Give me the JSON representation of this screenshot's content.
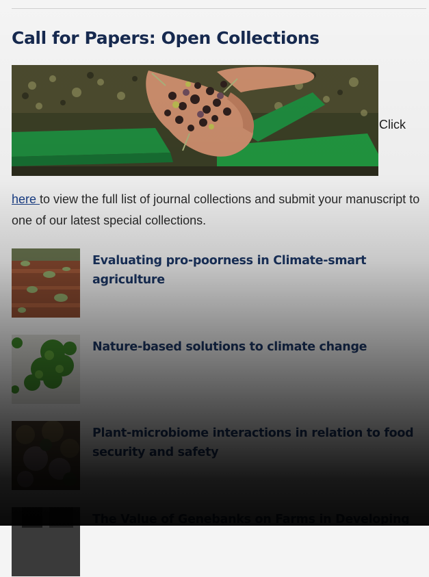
{
  "section": {
    "heading": "Call for Papers: Open Collections",
    "hero_image": "hands-holding-olives-photo",
    "click_word": "Click",
    "link_text": "here ",
    "paragraph_rest": "to view the full list of journal collections and submit your manuscript to one of our latest special collections."
  },
  "collections": [
    {
      "title": "Evaluating pro-poorness in Climate-smart agriculture",
      "thumbnail": "seedlings-soil-photo"
    },
    {
      "title": "Nature-based solutions to climate change",
      "thumbnail": "green-leaves-photo"
    },
    {
      "title": "Plant-microbiome interactions in relation to food security and safety",
      "thumbnail": "dense-shrubs-photo"
    },
    {
      "title": "The Value of Genebanks on Farms in Developing",
      "thumbnail": "dark-photo"
    }
  ],
  "colors": {
    "heading": "#16294f",
    "link": "#183e88",
    "item_title": "#1c3766"
  }
}
